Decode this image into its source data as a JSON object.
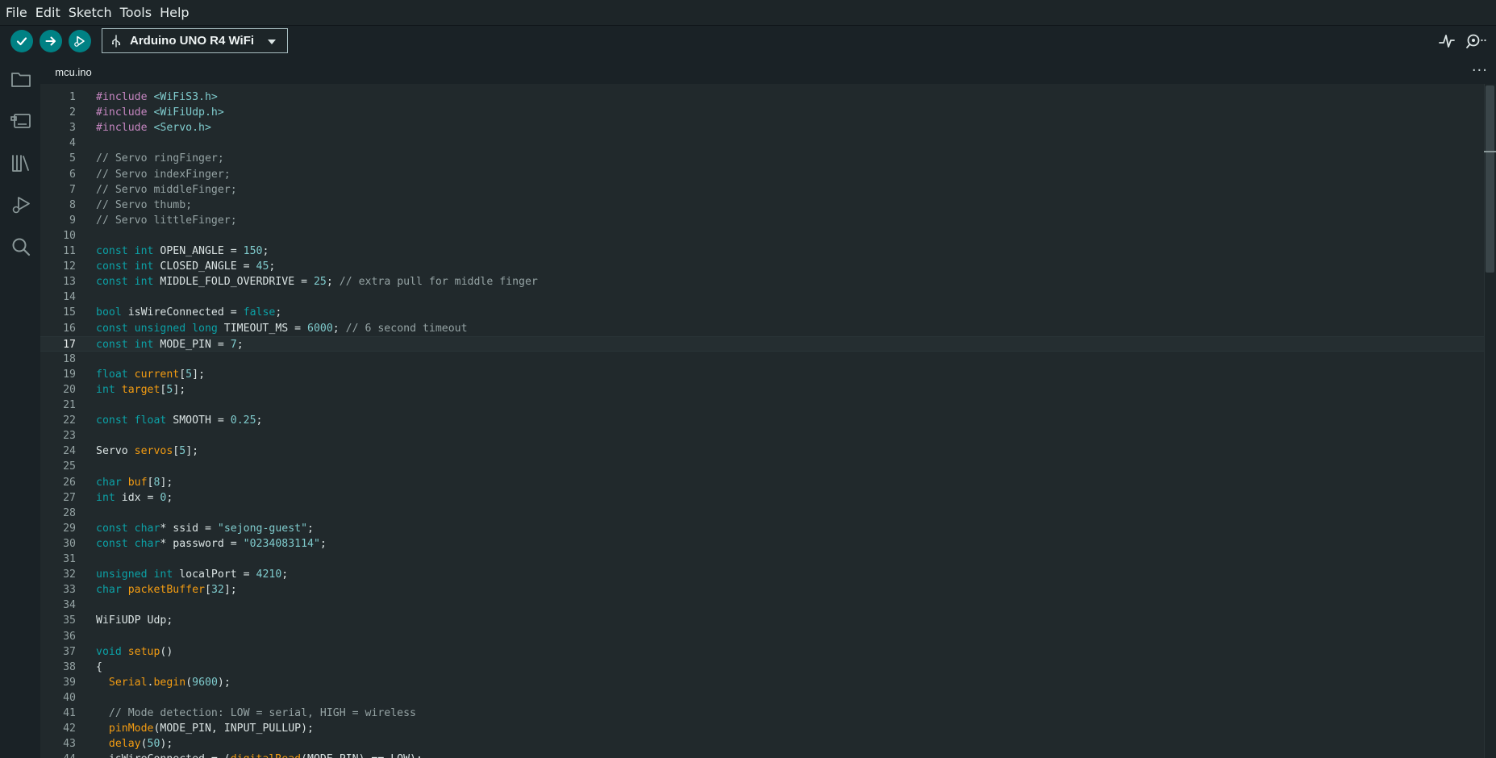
{
  "menu": [
    "File",
    "Edit",
    "Sketch",
    "Tools",
    "Help"
  ],
  "toolbar": {
    "board": "Arduino UNO R4 WiFi",
    "verify_icon": "check-icon",
    "upload_icon": "arrow-right-icon",
    "debug_icon": "debug-icon",
    "plotter_icon": "serial-plotter-icon",
    "monitor_icon": "serial-monitor-icon"
  },
  "sidebar": [
    "folder-icon",
    "board-manager-icon",
    "library-icon",
    "debug-icon",
    "search-icon"
  ],
  "tab": {
    "name": "mcu.ino",
    "more": "···"
  },
  "editor": {
    "current_line": 17,
    "lines": [
      [
        [
          "t-pre",
          "#include "
        ],
        [
          "t-inc",
          "<WiFiS3.h>"
        ]
      ],
      [
        [
          "t-pre",
          "#include "
        ],
        [
          "t-inc",
          "<WiFiUdp.h>"
        ]
      ],
      [
        [
          "t-pre",
          "#include "
        ],
        [
          "t-inc",
          "<Servo.h>"
        ]
      ],
      [],
      [
        [
          "t-com",
          "// Servo ringFinger;"
        ]
      ],
      [
        [
          "t-com",
          "// Servo indexFinger;"
        ]
      ],
      [
        [
          "t-com",
          "// Servo middleFinger;"
        ]
      ],
      [
        [
          "t-com",
          "// Servo thumb;"
        ]
      ],
      [
        [
          "t-com",
          "// Servo littleFinger;"
        ]
      ],
      [],
      [
        [
          "t-kw",
          "const int "
        ],
        [
          "t-txt",
          "OPEN_ANGLE = "
        ],
        [
          "t-num",
          "150"
        ],
        [
          "t-txt",
          ";"
        ]
      ],
      [
        [
          "t-kw",
          "const int "
        ],
        [
          "t-txt",
          "CLOSED_ANGLE = "
        ],
        [
          "t-num",
          "45"
        ],
        [
          "t-txt",
          ";"
        ]
      ],
      [
        [
          "t-kw",
          "const int "
        ],
        [
          "t-txt",
          "MIDDLE_FOLD_OVERDRIVE = "
        ],
        [
          "t-num",
          "25"
        ],
        [
          "t-txt",
          "; "
        ],
        [
          "t-com",
          "// extra pull for middle finger"
        ]
      ],
      [],
      [
        [
          "t-kw",
          "bool "
        ],
        [
          "t-txt",
          "isWireConnected = "
        ],
        [
          "t-kw",
          "false"
        ],
        [
          "t-txt",
          ";"
        ]
      ],
      [
        [
          "t-kw",
          "const unsigned long "
        ],
        [
          "t-txt",
          "TIMEOUT_MS = "
        ],
        [
          "t-num",
          "6000"
        ],
        [
          "t-txt",
          "; "
        ],
        [
          "t-com",
          "// 6 second timeout"
        ]
      ],
      [
        [
          "t-kw",
          "const int "
        ],
        [
          "t-txt",
          "MODE_PIN = "
        ],
        [
          "t-num",
          "7"
        ],
        [
          "t-txt",
          ";"
        ]
      ],
      [],
      [
        [
          "t-kw",
          "float "
        ],
        [
          "t-fn",
          "current"
        ],
        [
          "t-txt",
          "["
        ],
        [
          "t-num",
          "5"
        ],
        [
          "t-txt",
          "];"
        ]
      ],
      [
        [
          "t-kw",
          "int "
        ],
        [
          "t-fn",
          "target"
        ],
        [
          "t-txt",
          "["
        ],
        [
          "t-num",
          "5"
        ],
        [
          "t-txt",
          "];"
        ]
      ],
      [],
      [
        [
          "t-kw",
          "const float "
        ],
        [
          "t-txt",
          "SMOOTH = "
        ],
        [
          "t-num",
          "0.25"
        ],
        [
          "t-txt",
          ";"
        ]
      ],
      [],
      [
        [
          "t-txt",
          "Servo "
        ],
        [
          "t-fn",
          "servos"
        ],
        [
          "t-txt",
          "["
        ],
        [
          "t-num",
          "5"
        ],
        [
          "t-txt",
          "];"
        ]
      ],
      [],
      [
        [
          "t-kw",
          "char "
        ],
        [
          "t-fn",
          "buf"
        ],
        [
          "t-txt",
          "["
        ],
        [
          "t-num",
          "8"
        ],
        [
          "t-txt",
          "];"
        ]
      ],
      [
        [
          "t-kw",
          "int "
        ],
        [
          "t-txt",
          "idx = "
        ],
        [
          "t-num",
          "0"
        ],
        [
          "t-txt",
          ";"
        ]
      ],
      [],
      [
        [
          "t-kw",
          "const char"
        ],
        [
          "t-txt",
          "* ssid = "
        ],
        [
          "t-str",
          "\"sejong-guest\""
        ],
        [
          "t-txt",
          ";"
        ]
      ],
      [
        [
          "t-kw",
          "const char"
        ],
        [
          "t-txt",
          "* password = "
        ],
        [
          "t-str",
          "\"0234083114\""
        ],
        [
          "t-txt",
          ";"
        ]
      ],
      [],
      [
        [
          "t-kw",
          "unsigned int "
        ],
        [
          "t-txt",
          "localPort = "
        ],
        [
          "t-num",
          "4210"
        ],
        [
          "t-txt",
          ";"
        ]
      ],
      [
        [
          "t-kw",
          "char "
        ],
        [
          "t-fn",
          "packetBuffer"
        ],
        [
          "t-txt",
          "["
        ],
        [
          "t-num",
          "32"
        ],
        [
          "t-txt",
          "];"
        ]
      ],
      [],
      [
        [
          "t-txt",
          "WiFiUDP Udp;"
        ]
      ],
      [],
      [
        [
          "t-kw",
          "void "
        ],
        [
          "t-fn",
          "setup"
        ],
        [
          "t-txt",
          "()"
        ]
      ],
      [
        [
          "t-txt",
          "{"
        ]
      ],
      [
        [
          "t-txt",
          "  "
        ],
        [
          "t-fn",
          "Serial"
        ],
        [
          "t-txt",
          "."
        ],
        [
          "t-fn",
          "begin"
        ],
        [
          "t-txt",
          "("
        ],
        [
          "t-num",
          "9600"
        ],
        [
          "t-txt",
          ");"
        ]
      ],
      [],
      [
        [
          "t-txt",
          "  "
        ],
        [
          "t-com",
          "// Mode detection: LOW = serial, HIGH = wireless"
        ]
      ],
      [
        [
          "t-txt",
          "  "
        ],
        [
          "t-fn",
          "pinMode"
        ],
        [
          "t-txt",
          "(MODE_PIN, INPUT_PULLUP);"
        ]
      ],
      [
        [
          "t-txt",
          "  "
        ],
        [
          "t-fn",
          "delay"
        ],
        [
          "t-txt",
          "("
        ],
        [
          "t-num",
          "50"
        ],
        [
          "t-txt",
          ");"
        ]
      ],
      [
        [
          "t-txt",
          "  isWireConnected = ("
        ],
        [
          "t-fn",
          "digitalRead"
        ],
        [
          "t-txt",
          "(MODE_PIN) == LOW);"
        ]
      ]
    ]
  }
}
